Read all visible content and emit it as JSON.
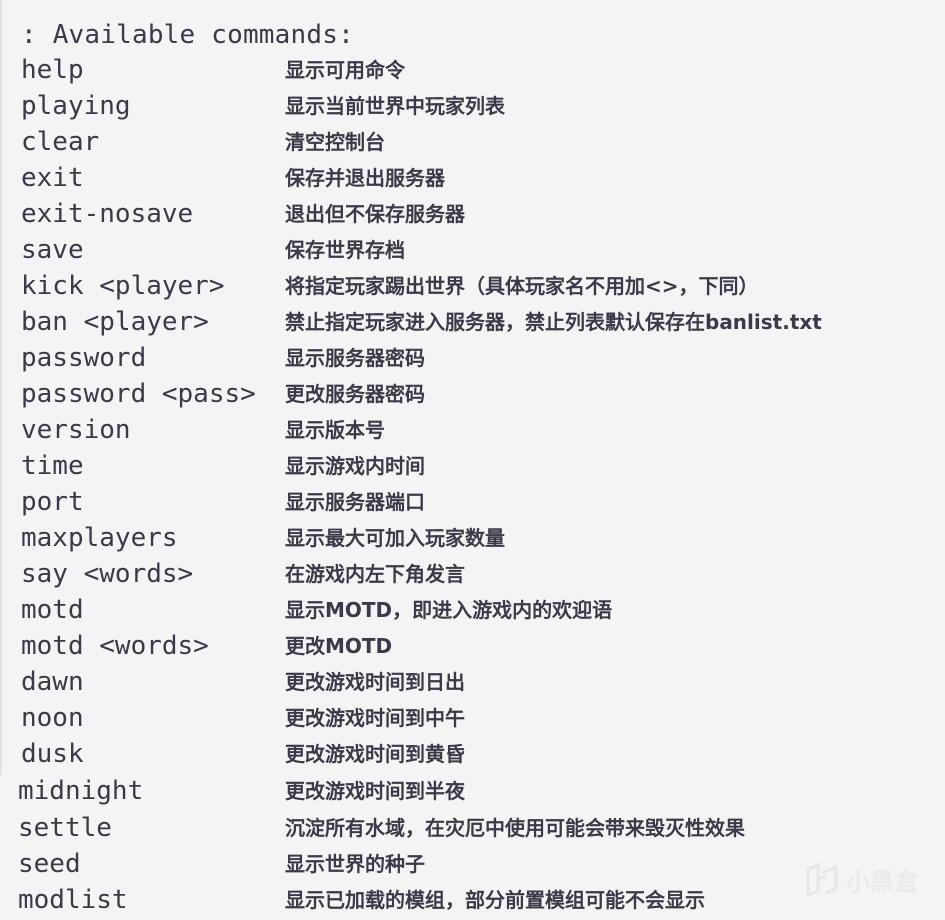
{
  "header": ": Available commands:",
  "commands": [
    {
      "cmd": "help",
      "desc": "显示可用命令"
    },
    {
      "cmd": "playing",
      "desc": "显示当前世界中玩家列表"
    },
    {
      "cmd": "clear",
      "desc": "清空控制台"
    },
    {
      "cmd": "exit",
      "desc": "保存并退出服务器"
    },
    {
      "cmd": "exit-nosave",
      "desc": "退出但不保存服务器"
    },
    {
      "cmd": "save",
      "desc": "保存世界存档"
    },
    {
      "cmd": "kick <player>",
      "desc": "将指定玩家踢出世界（具体玩家名不用加<>，下同）"
    },
    {
      "cmd": "ban <player>",
      "desc": "禁止指定玩家进入服务器，禁止列表默认保存在banlist.txt"
    },
    {
      "cmd": "password",
      "desc": "显示服务器密码"
    },
    {
      "cmd": "password <pass>",
      "desc": "更改服务器密码"
    },
    {
      "cmd": "version",
      "desc": "显示版本号"
    },
    {
      "cmd": "time",
      "desc": "显示游戏内时间"
    },
    {
      "cmd": "port",
      "desc": "显示服务器端口"
    },
    {
      "cmd": "maxplayers",
      "desc": "显示最大可加入玩家数量"
    },
    {
      "cmd": "say <words>",
      "desc": "在游戏内左下角发言"
    },
    {
      "cmd": "motd",
      "desc": "显示MOTD，即进入游戏内的欢迎语"
    },
    {
      "cmd": "motd <words>",
      "desc": "更改MOTD"
    },
    {
      "cmd": "dawn",
      "desc": "更改游戏时间到日出"
    },
    {
      "cmd": "noon",
      "desc": "更改游戏时间到中午"
    },
    {
      "cmd": "dusk",
      "desc": "更改游戏时间到黄昏"
    },
    {
      "cmd": "midnight",
      "desc": "更改游戏时间到半夜"
    },
    {
      "cmd": "settle",
      "desc": "沉淀所有水域，在灾厄中使用可能会带来毁灭性效果"
    },
    {
      "cmd": "seed",
      "desc": "显示世界的种子"
    },
    {
      "cmd": "modlist",
      "desc": "显示已加载的模组，部分前置模组可能不会显示"
    }
  ],
  "watermark": {
    "icon": "xiaoheihe-logo-icon",
    "text": "小黑盒"
  }
}
